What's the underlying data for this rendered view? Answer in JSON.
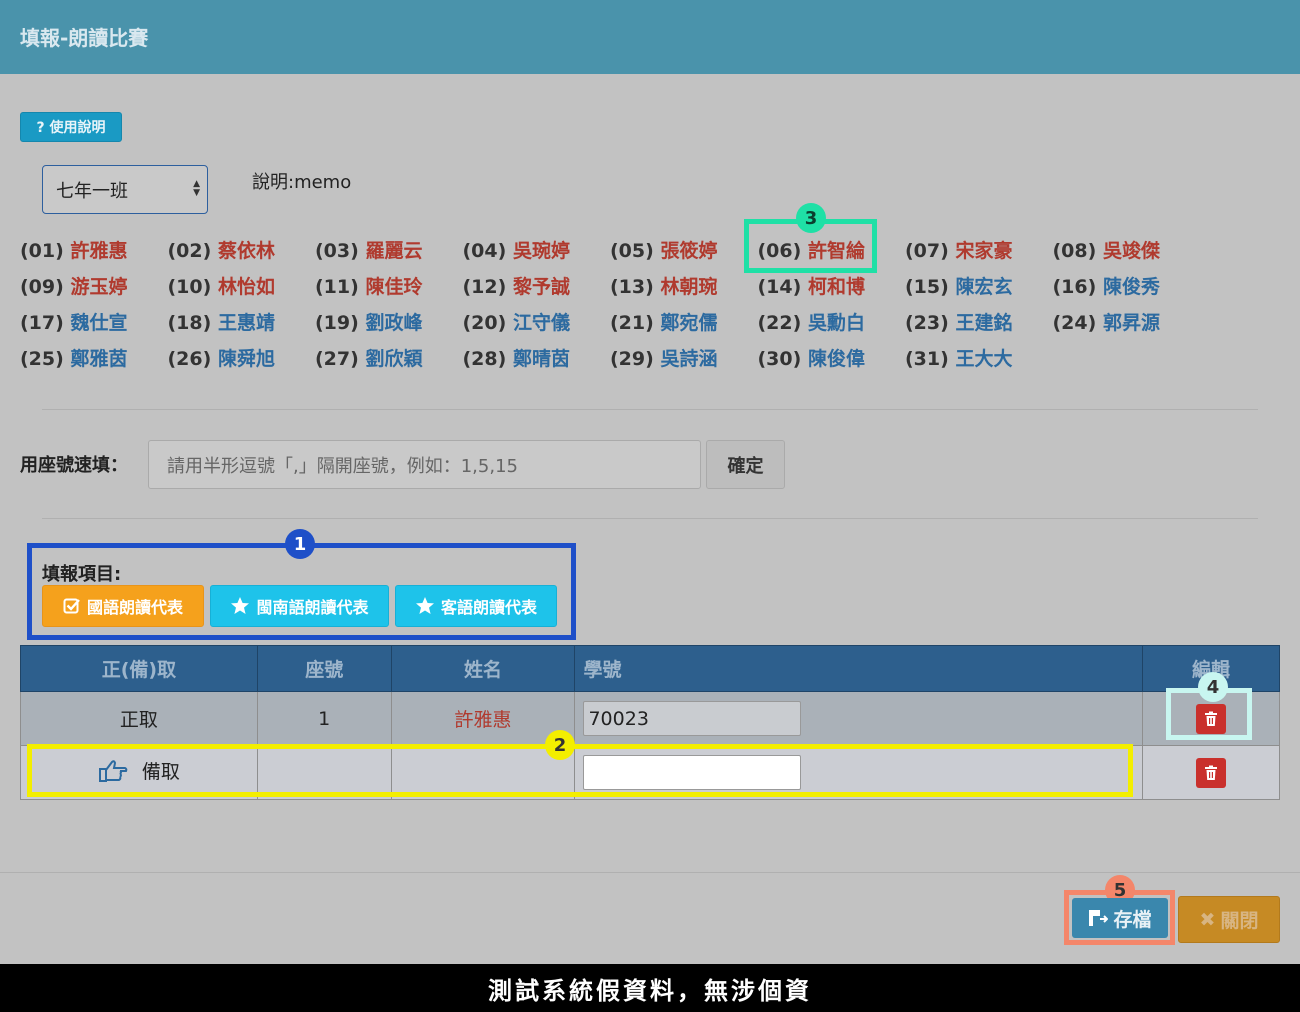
{
  "header": {
    "title": "填報-朗讀比賽"
  },
  "help_button": {
    "label": "? 使用說明"
  },
  "class_select": {
    "value": "七年一班"
  },
  "memo": "說明:memo",
  "students": [
    {
      "num": "(01)",
      "name": "許雅惠",
      "color": "red"
    },
    {
      "num": "(02)",
      "name": "蔡依林",
      "color": "red"
    },
    {
      "num": "(03)",
      "name": "羅麗云",
      "color": "red"
    },
    {
      "num": "(04)",
      "name": "吳琬婷",
      "color": "red"
    },
    {
      "num": "(05)",
      "name": "張筱婷",
      "color": "red"
    },
    {
      "num": "(06)",
      "name": "許智綸",
      "color": "red"
    },
    {
      "num": "(07)",
      "name": "宋家豪",
      "color": "red"
    },
    {
      "num": "(08)",
      "name": "吳竣傑",
      "color": "red"
    },
    {
      "num": "(09)",
      "name": "游玉婷",
      "color": "red"
    },
    {
      "num": "(10)",
      "name": "林怡如",
      "color": "red"
    },
    {
      "num": "(11)",
      "name": "陳佳玲",
      "color": "red"
    },
    {
      "num": "(12)",
      "name": "黎予誠",
      "color": "red"
    },
    {
      "num": "(13)",
      "name": "林朝琬",
      "color": "red"
    },
    {
      "num": "(14)",
      "name": "柯和博",
      "color": "red"
    },
    {
      "num": "(15)",
      "name": "陳宏玄",
      "color": "blue"
    },
    {
      "num": "(16)",
      "name": "陳俊秀",
      "color": "blue"
    },
    {
      "num": "(17)",
      "name": "魏仕宣",
      "color": "blue"
    },
    {
      "num": "(18)",
      "name": "王惠靖",
      "color": "blue"
    },
    {
      "num": "(19)",
      "name": "劉政峰",
      "color": "blue"
    },
    {
      "num": "(20)",
      "name": "江守儀",
      "color": "blue"
    },
    {
      "num": "(21)",
      "name": "鄭宛儒",
      "color": "blue"
    },
    {
      "num": "(22)",
      "name": "吳勳白",
      "color": "blue"
    },
    {
      "num": "(23)",
      "name": "王建銘",
      "color": "blue"
    },
    {
      "num": "(24)",
      "name": "郭昇源",
      "color": "blue"
    },
    {
      "num": "(25)",
      "name": "鄭雅茵",
      "color": "blue"
    },
    {
      "num": "(26)",
      "name": "陳舜旭",
      "color": "blue"
    },
    {
      "num": "(27)",
      "name": "劉欣穎",
      "color": "blue"
    },
    {
      "num": "(28)",
      "name": "鄭晴茵",
      "color": "blue"
    },
    {
      "num": "(29)",
      "name": "吳詩涵",
      "color": "blue"
    },
    {
      "num": "(30)",
      "name": "陳俊偉",
      "color": "blue"
    },
    {
      "num": "(31)",
      "name": "王大大",
      "color": "blue"
    }
  ],
  "quick_fill": {
    "label": "用座號速填：",
    "placeholder": "請用半形逗號「,」隔開座號，例如：1,5,15",
    "confirm_label": "確定"
  },
  "items": {
    "label": "填報項目:",
    "buttons": [
      "國語朗讀代表",
      "閩南語朗讀代表",
      "客語朗讀代表"
    ]
  },
  "table": {
    "headers": [
      "正(備)取",
      "座號",
      "姓名",
      "學號",
      "編輯"
    ],
    "rows": [
      {
        "type": "正取",
        "seat": "1",
        "name": "許雅惠",
        "student_id": "70023"
      },
      {
        "type": "備取",
        "seat": "",
        "name": "",
        "student_id": ""
      }
    ]
  },
  "badges": [
    "1",
    "2",
    "3",
    "4",
    "5"
  ],
  "save_label": "存檔",
  "close_label": "關閉",
  "footer": "測試系統假資料，無涉個資",
  "colors": {
    "header_bg": "#4a93ab",
    "red_name": "#b03a2e",
    "blue_name": "#2c6aa0",
    "badge_blue": "#1e4fc8",
    "badge_yellow": "#f3ee00",
    "badge_green": "#1fe0a6",
    "badge_cyan": "#c8f6f0",
    "badge_orange": "#f4866a"
  }
}
